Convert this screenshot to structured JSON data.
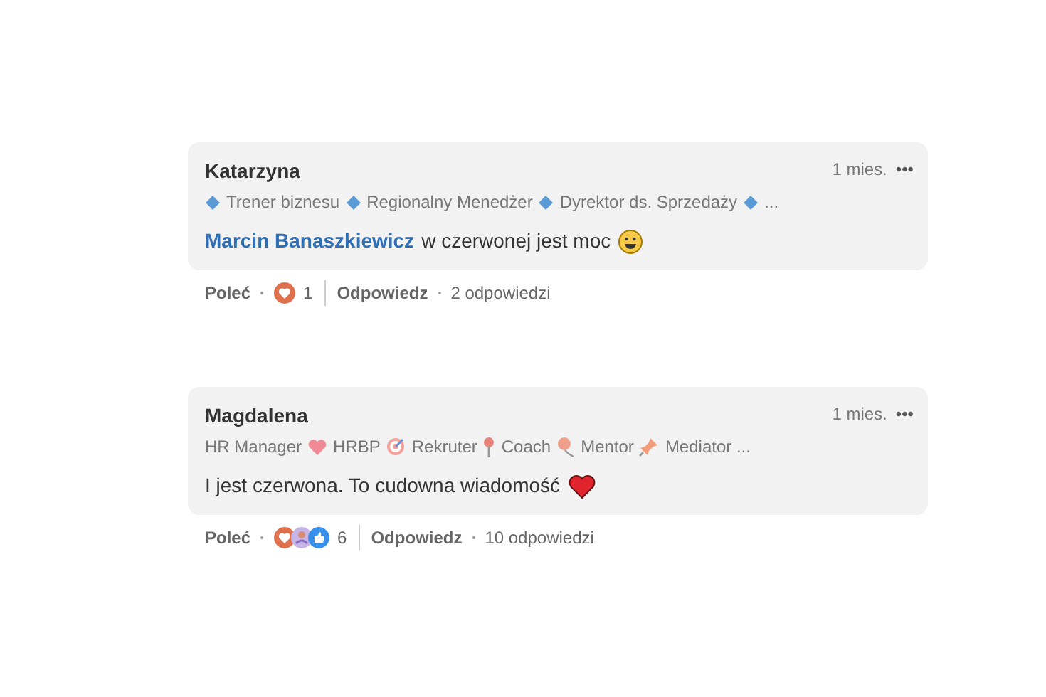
{
  "comments": [
    {
      "author": "Katarzyna",
      "time": "1 mies.",
      "more": "•••",
      "headline": [
        {
          "kind": "diamond"
        },
        {
          "kind": "text",
          "text": "Trener biznesu"
        },
        {
          "kind": "diamond"
        },
        {
          "kind": "text",
          "text": "Regionalny Menedżer"
        },
        {
          "kind": "diamond"
        },
        {
          "kind": "text",
          "text": "Dyrektor ds. Sprzedaży"
        },
        {
          "kind": "diamond"
        },
        {
          "kind": "text",
          "text": "..."
        }
      ],
      "mention": "Marcin Banaszkiewicz",
      "message": "w czerwonej jest moc",
      "emoji": {
        "kind": "smile"
      },
      "like": "Poleć",
      "reactions": [
        {
          "kind": "love"
        }
      ],
      "reaction_count": "1",
      "reply": "Odpowiedz",
      "replies": "2 odpowiedzi"
    },
    {
      "author": "Magdalena",
      "time": "1 mies.",
      "more": "•••",
      "headline": [
        {
          "kind": "text",
          "text": "HR Manager"
        },
        {
          "kind": "heart"
        },
        {
          "kind": "text",
          "text": "HRBP"
        },
        {
          "kind": "target"
        },
        {
          "kind": "text",
          "text": "Rekruter"
        },
        {
          "kind": "pin"
        },
        {
          "kind": "text",
          "text": "Coach"
        },
        {
          "kind": "balloon"
        },
        {
          "kind": "text",
          "text": "Mentor"
        },
        {
          "kind": "pushpin"
        },
        {
          "kind": "text",
          "text": "Mediator ..."
        }
      ],
      "message": "I jest czerwona. To cudowna wiadomość",
      "emoji": {
        "kind": "heart"
      },
      "like": "Poleć",
      "reactions": [
        {
          "kind": "love"
        },
        {
          "kind": "support"
        },
        {
          "kind": "like"
        }
      ],
      "reaction_count": "6",
      "reply": "Odpowiedz",
      "replies": "10 odpowiedzi"
    }
  ]
}
